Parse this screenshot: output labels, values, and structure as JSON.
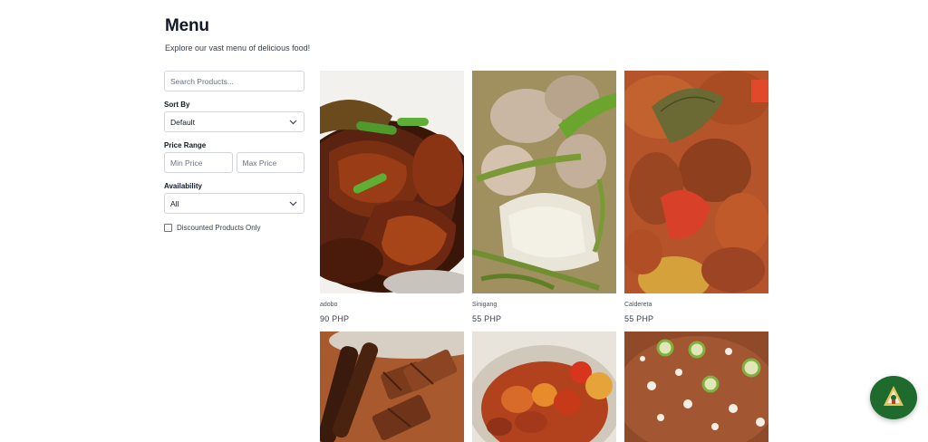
{
  "header": {
    "title": "Menu",
    "subtitle": "Explore our vast menu of delicious food!"
  },
  "filters": {
    "search_placeholder": "Search Products...",
    "sort_label": "Sort By",
    "sort_value": "Default",
    "price_label": "Price Range",
    "min_placeholder": "Min Price",
    "max_placeholder": "Max Price",
    "availability_label": "Availability",
    "availability_value": "All",
    "discount_label": "Discounted Products Only"
  },
  "products": [
    {
      "name": "adobo",
      "price": "90 PHP"
    },
    {
      "name": "Sinigang",
      "price": "55 PHP"
    },
    {
      "name": "Caldereta",
      "price": "55 PHP"
    },
    {
      "name": "",
      "price": ""
    },
    {
      "name": "",
      "price": ""
    },
    {
      "name": "",
      "price": ""
    }
  ],
  "icons": {
    "sort_chevron": "chevron-down-icon",
    "availability_chevron": "chevron-down-icon",
    "fab": "chat-assistant-icon"
  },
  "colors": {
    "fab_background": "#1f6b2e",
    "border": "#d1d5db",
    "text": "#111827"
  }
}
